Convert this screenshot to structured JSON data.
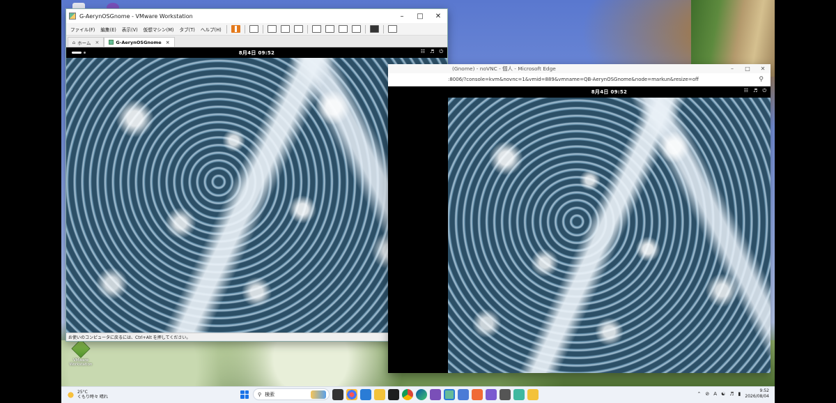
{
  "vmware": {
    "title": "G-AerynOSGnome - VMware Workstation",
    "menu": [
      "ファイル(F)",
      "編集(E)",
      "表示(V)",
      "仮想マシン(M)",
      "タブ(T)",
      "ヘルプ(H)"
    ],
    "tabs": [
      "ホーム",
      "G-AerynOSGnome"
    ],
    "guest_clock": "8月4日  09:52",
    "status_text": "お使いのコンピュータに戻るには、Ctrl+Alt を押してください。"
  },
  "edge": {
    "title": "(Gnome) - noVNC - 個人 - Microsoft Edge",
    "address": ":8006/?console=kvm&novnc=1&vmid=889&vmname=QB-AerynOSGnome&node=markun&resize=off",
    "guest_clock": "8月4日  09:52"
  },
  "desktop_icon_label": "VMware Workstation",
  "taskbar": {
    "weather_temp": "25°C",
    "weather_desc": "くもり時々 晴れ",
    "search_placeholder": "検索",
    "time": "9:52",
    "date": "2026/08/04",
    "ime": "A"
  },
  "colors": {
    "vmware_accent": "#e47a1c",
    "windows_blue": "#1a73e8"
  }
}
